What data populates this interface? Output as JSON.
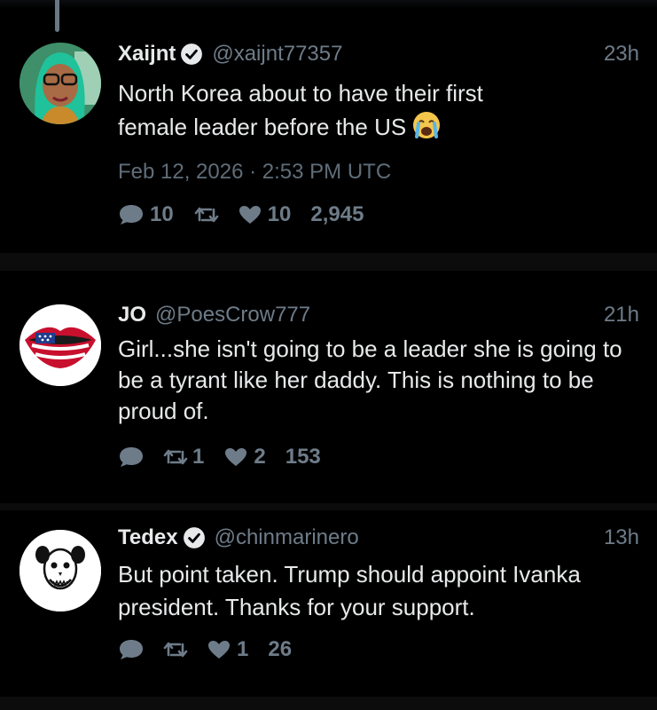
{
  "tweets": [
    {
      "name": "Xaijnt",
      "verified": true,
      "handle": "@xaijnt77357",
      "time": "23h",
      "text_lines": [
        "North Korea about to have their first",
        "female leader before the US"
      ],
      "emoji": "crying-face",
      "timestamp": "Feb 12, 2026 · 2:53 PM UTC",
      "stats": {
        "replies": "10",
        "retweets": "",
        "likes": "10",
        "views": "2,945"
      }
    },
    {
      "name": "JO",
      "verified": false,
      "handle": "@PoesCrow777",
      "time": "21h",
      "text_lines": [
        "Girl...she isn't going to be a leader she is going to",
        "be a tyrant like her daddy. This is nothing to be",
        "proud of."
      ],
      "stats": {
        "replies": "",
        "retweets": "1",
        "likes": "2",
        "views": "153"
      }
    },
    {
      "name": "Tedex",
      "verified": true,
      "handle": "@chinmarinero",
      "time": "13h",
      "text_lines": [
        "But point taken. Trump should appoint Ivanka",
        "president. Thanks for your support."
      ],
      "stats": {
        "replies": "",
        "retweets": "",
        "likes": "1",
        "views": "26"
      }
    }
  ],
  "colors": {
    "background": "#000000",
    "text": "#e7e9ea",
    "muted": "#6e7c89",
    "divider": "#0c0c0c"
  }
}
